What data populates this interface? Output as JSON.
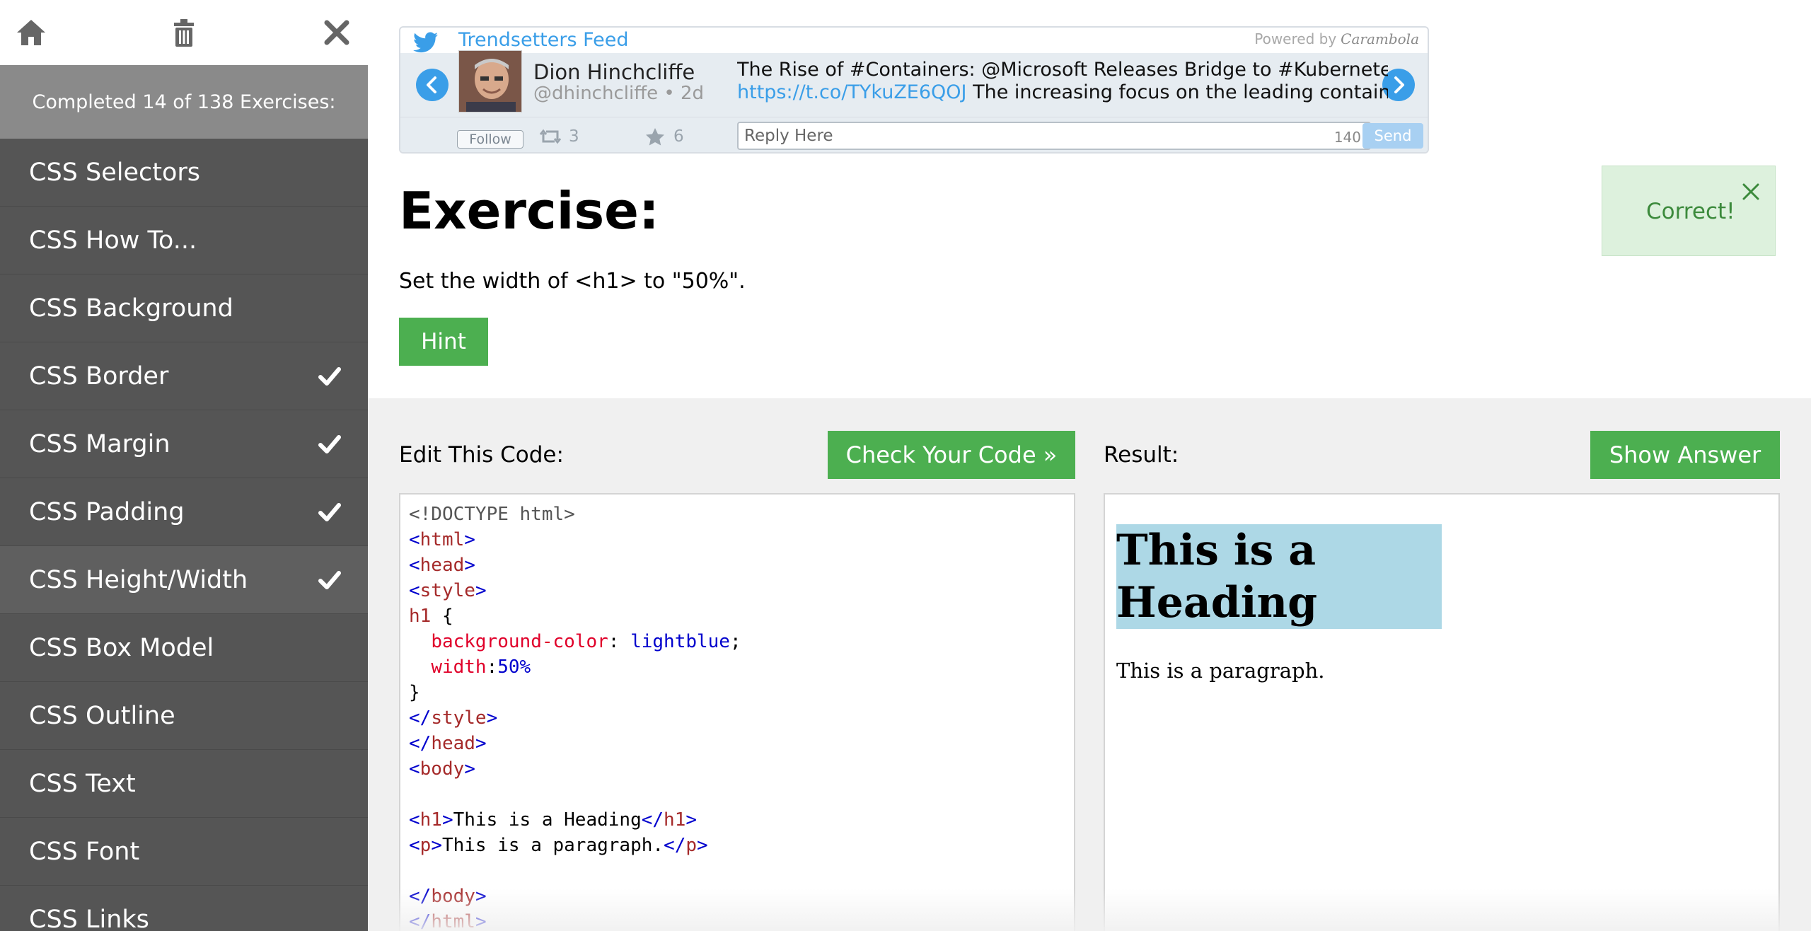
{
  "sidebar": {
    "icons": {
      "home": "home-icon",
      "trash": "trash-icon",
      "close": "close-icon"
    },
    "progress": "Completed 14 of 138 Exercises:",
    "items": [
      {
        "label": "CSS Selectors",
        "done": false
      },
      {
        "label": "CSS How To...",
        "done": false
      },
      {
        "label": "CSS Background",
        "done": false
      },
      {
        "label": "CSS Border",
        "done": true
      },
      {
        "label": "CSS Margin",
        "done": true
      },
      {
        "label": "CSS Padding",
        "done": true
      },
      {
        "label": "CSS Height/Width",
        "done": true,
        "active": true
      },
      {
        "label": "CSS Box Model",
        "done": false
      },
      {
        "label": "CSS Outline",
        "done": false
      },
      {
        "label": "CSS Text",
        "done": false
      },
      {
        "label": "CSS Font",
        "done": false
      },
      {
        "label": "CSS Links",
        "done": false
      }
    ]
  },
  "twitter": {
    "feed_title": "Trendsetters Feed",
    "powered_by": "Powered by",
    "powered_brand": "Carambola",
    "author_name": "Dion Hinchcliffe",
    "author_handle": "@dhinchcliffe • 2d",
    "tweet_line1": "The Rise of #Containers: @Microsoft Releases Bridge to #Kubernetes",
    "tweet_link": "https://t.co/TYkuZE6QOJ",
    "tweet_line2_rest": " The increasing focus on the leading container...",
    "follow_label": "Follow",
    "retweets": "3",
    "likes": "6",
    "reply_placeholder": "Reply Here",
    "char_count": "140",
    "send_label": "Send",
    "accent_color": "#3a9ee8"
  },
  "exercise": {
    "title": "Exercise:",
    "instruction": "Set the width of <h1> to \"50%\".",
    "hint_label": "Hint",
    "feedback": "Correct!"
  },
  "editor": {
    "label": "Edit This Code:",
    "check_label": "Check Your Code »",
    "code_lines": [
      [
        {
          "t": "<!DOCTYPE html>",
          "c": "doc"
        }
      ],
      [
        {
          "t": "<",
          "c": "tag"
        },
        {
          "t": "html",
          "c": "name"
        },
        {
          "t": ">",
          "c": "tag"
        }
      ],
      [
        {
          "t": "<",
          "c": "tag"
        },
        {
          "t": "head",
          "c": "name"
        },
        {
          "t": ">",
          "c": "tag"
        }
      ],
      [
        {
          "t": "<",
          "c": "tag"
        },
        {
          "t": "style",
          "c": "name"
        },
        {
          "t": ">",
          "c": "tag"
        }
      ],
      [
        {
          "t": "h1",
          "c": "name"
        },
        {
          "t": " {",
          "c": "txt"
        }
      ],
      [
        {
          "t": "  ",
          "c": "txt"
        },
        {
          "t": "background-color",
          "c": "prop"
        },
        {
          "t": ": ",
          "c": "txt"
        },
        {
          "t": "lightblue",
          "c": "val"
        },
        {
          "t": ";",
          "c": "txt"
        }
      ],
      [
        {
          "t": "  ",
          "c": "txt"
        },
        {
          "t": "width",
          "c": "prop"
        },
        {
          "t": ":",
          "c": "txt"
        },
        {
          "t": "50%",
          "c": "val"
        }
      ],
      [
        {
          "t": "}",
          "c": "txt"
        }
      ],
      [
        {
          "t": "</",
          "c": "tag"
        },
        {
          "t": "style",
          "c": "name"
        },
        {
          "t": ">",
          "c": "tag"
        }
      ],
      [
        {
          "t": "</",
          "c": "tag"
        },
        {
          "t": "head",
          "c": "name"
        },
        {
          "t": ">",
          "c": "tag"
        }
      ],
      [
        {
          "t": "<",
          "c": "tag"
        },
        {
          "t": "body",
          "c": "name"
        },
        {
          "t": ">",
          "c": "tag"
        }
      ],
      [],
      [
        {
          "t": "<",
          "c": "tag"
        },
        {
          "t": "h1",
          "c": "name"
        },
        {
          "t": ">",
          "c": "tag"
        },
        {
          "t": "This is a Heading",
          "c": "txt"
        },
        {
          "t": "</",
          "c": "tag"
        },
        {
          "t": "h1",
          "c": "name"
        },
        {
          "t": ">",
          "c": "tag"
        }
      ],
      [
        {
          "t": "<",
          "c": "tag"
        },
        {
          "t": "p",
          "c": "name"
        },
        {
          "t": ">",
          "c": "tag"
        },
        {
          "t": "This is a paragraph.",
          "c": "txt"
        },
        {
          "t": "</",
          "c": "tag"
        },
        {
          "t": "p",
          "c": "name"
        },
        {
          "t": ">",
          "c": "tag"
        }
      ],
      [],
      [
        {
          "t": "</",
          "c": "tag"
        },
        {
          "t": "body",
          "c": "name"
        },
        {
          "t": ">",
          "c": "tag"
        }
      ],
      [
        {
          "t": "</",
          "c": "tag"
        },
        {
          "t": "html",
          "c": "name"
        },
        {
          "t": ">",
          "c": "tag"
        }
      ]
    ]
  },
  "result": {
    "label": "Result:",
    "answer_label": "Show Answer",
    "heading": "This is a Heading",
    "paragraph": "This is a paragraph.",
    "heading_bg": "#add8e6"
  },
  "colors": {
    "sidebar_bg": "#555555",
    "progress_bg": "#8a8a8a",
    "button_green": "#4caf50",
    "correct_bg": "#ddf1dd"
  }
}
